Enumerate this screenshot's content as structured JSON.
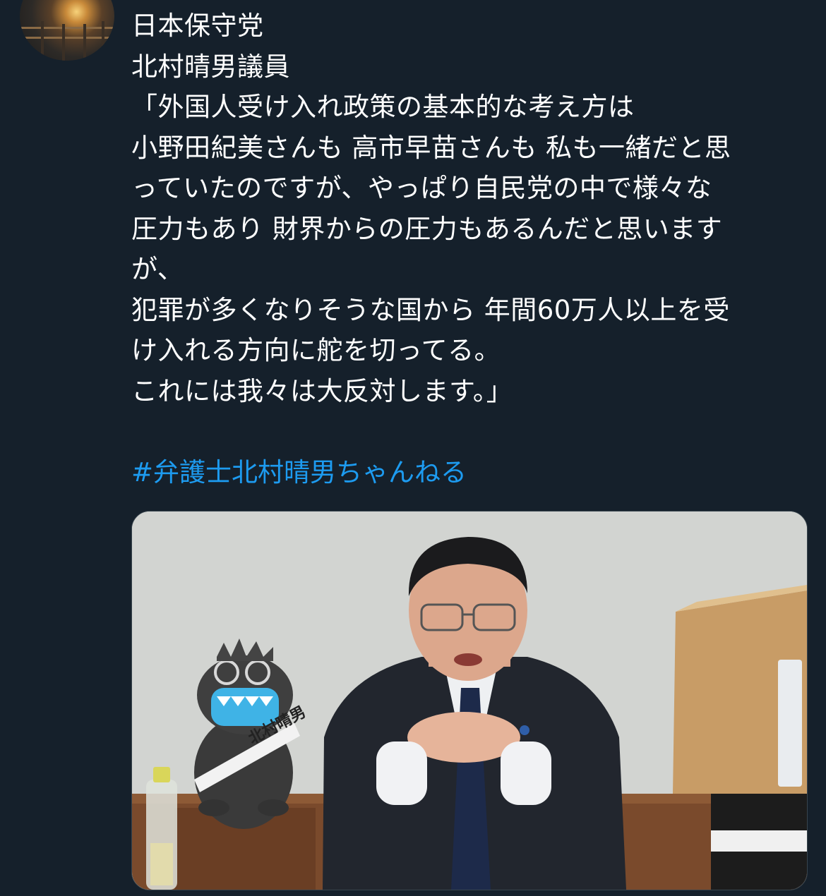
{
  "tweet": {
    "lines": [
      "日本保守党",
      "北村晴男議員",
      "「外国人受け入れ政策の基本的な考え方は",
      "小野田紀美さんも 高市早苗さんも 私も一緒だと思",
      "っていたのですが、やっぱり自民党の中で様々な",
      "圧力もあり 財界からの圧力もあるんだと思います",
      "が、",
      "犯罪が多くなりそうな国から 年間60万人以上を受",
      "け入れる方向に舵を切ってる。",
      "これには我々は大反対します。」"
    ],
    "hashtag": "#弁護士北村晴男ちゃんねる",
    "sash_text": "北村晴男"
  },
  "colors": {
    "background": "#15202b",
    "text": "#ffffff",
    "link": "#1d9bf0"
  }
}
